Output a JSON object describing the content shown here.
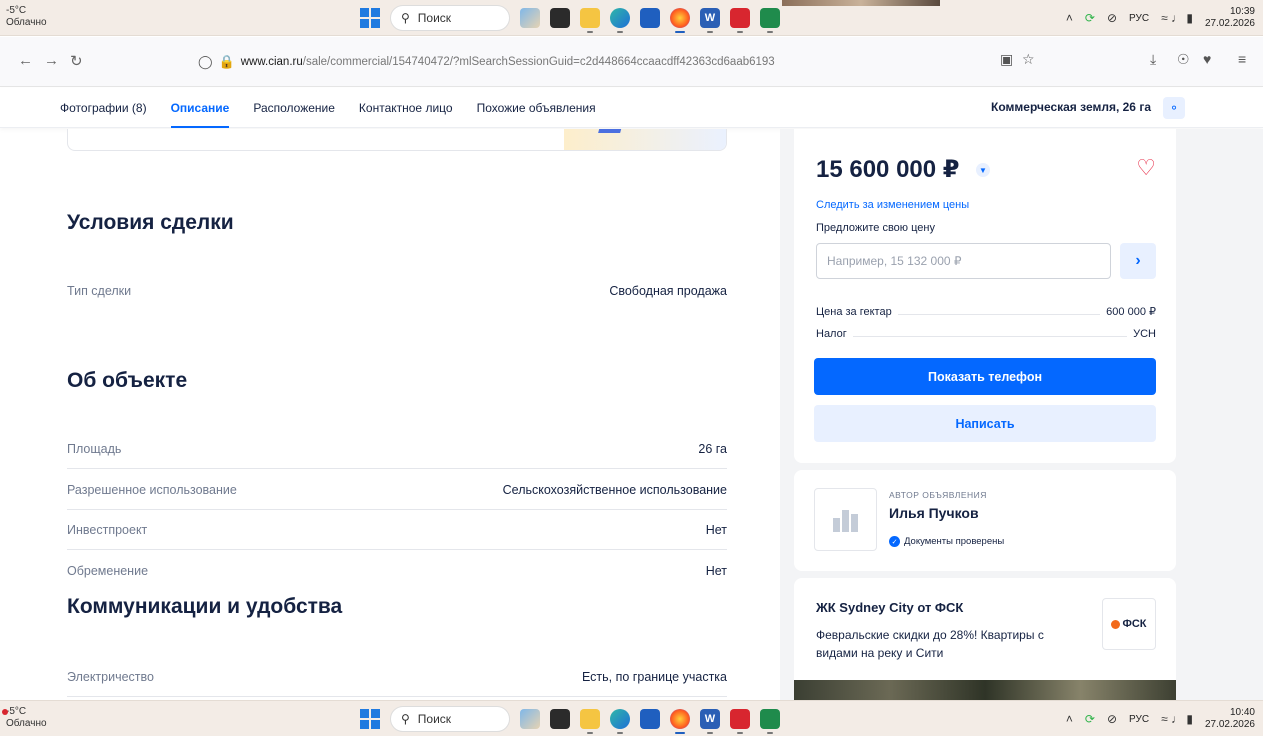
{
  "taskbar": {
    "weather_temp": "-5°C",
    "weather_desc": "Облачно",
    "search_label": "Поиск",
    "lang": "РУС",
    "top_time": "10:39",
    "top_date": "27.02.2026",
    "bottom_time": "10:40",
    "bottom_date": "27.02.2026"
  },
  "browser": {
    "url_domain": "www.cian.ru",
    "url_path": "/sale/commercial/154740472/?mlSearchSessionGuid=c2d448664ccaacdff42363cd6aab6193"
  },
  "page_nav": {
    "tabs": [
      {
        "label": "Фотографии (8)",
        "active": false
      },
      {
        "label": "Описание",
        "active": true
      },
      {
        "label": "Расположение",
        "active": false
      },
      {
        "label": "Контактное лицо",
        "active": false
      },
      {
        "label": "Похожие объявления",
        "active": false
      }
    ],
    "summary": "Коммерческая земля, 26 га"
  },
  "deal": {
    "title": "Условия сделки",
    "rows": [
      {
        "label": "Тип сделки",
        "value": "Свободная продажа"
      }
    ]
  },
  "object": {
    "title": "Об объекте",
    "rows": [
      {
        "label": "Площадь",
        "value": "26 га"
      },
      {
        "label": "Разрешенное использование",
        "value": "Сельскохозяйственное использование"
      },
      {
        "label": "Инвестпроект",
        "value": "Нет"
      },
      {
        "label": "Обременение",
        "value": "Нет"
      }
    ]
  },
  "communications": {
    "title": "Коммуникации и удобства",
    "rows": [
      {
        "label": "Электричество",
        "value": "Есть, по границе участка"
      }
    ]
  },
  "price_card": {
    "price": "15 600 000 ₽",
    "follow_link": "Следить за изменением цены",
    "offer_label": "Предложите свою цену",
    "offer_placeholder": "Например, 15 132 000 ₽",
    "price_per_ha_label": "Цена за гектар",
    "price_per_ha_value": "600 000 ₽",
    "tax_label": "Налог",
    "tax_value": "УСН",
    "show_phone": "Показать телефон",
    "write": "Написать"
  },
  "author": {
    "caption": "АВТОР ОБЪЯВЛЕНИЯ",
    "name": "Илья Пучков",
    "verified": "Документы проверены"
  },
  "ad": {
    "title": "ЖК Sydney City от ФСК",
    "text": "Февральские скидки до 28%! Квартиры с видами на реку и Сити",
    "logo_text": "ФСК"
  },
  "colors": {
    "accent": "#0468ff",
    "heart": "#e8344e",
    "text": "#152242",
    "muted": "#707a8f"
  }
}
